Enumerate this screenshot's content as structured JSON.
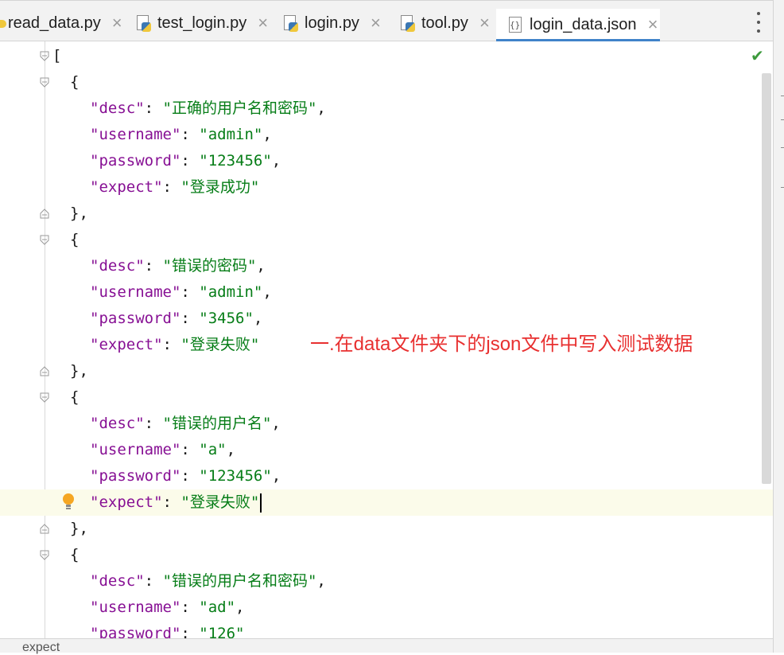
{
  "tabs": [
    {
      "label": "read_data.py",
      "close": "×",
      "icon": "python-file-icon"
    },
    {
      "label": "test_login.py",
      "close": "×",
      "icon": "python-file-icon"
    },
    {
      "label": "login.py",
      "close": "×",
      "icon": "python-file-icon"
    },
    {
      "label": "tool.py",
      "close": "×",
      "icon": "python-file-icon"
    },
    {
      "label": "login_data.json",
      "close": "×",
      "icon": "json-file-icon",
      "active": true
    }
  ],
  "colors": {
    "key": "#871094",
    "string": "#067d17",
    "annotation": "#e83030",
    "active_tab": "#4083c9"
  },
  "editor": {
    "lines": {
      "l0": "[",
      "l1": "{",
      "l2_key": "\"desc\"",
      "l2_val": "\"正确的用户名和密码\"",
      "l3_key": "\"username\"",
      "l3_val": "\"admin\"",
      "l4_key": "\"password\"",
      "l4_val": "\"123456\"",
      "l5_key": "\"expect\"",
      "l5_val": "\"登录成功\"",
      "l6": "},",
      "l7": "{",
      "l8_key": "\"desc\"",
      "l8_val": "\"错误的密码\"",
      "l9_key": "\"username\"",
      "l9_val": "\"admin\"",
      "l10_key": "\"password\"",
      "l10_val": "\"3456\"",
      "l11_key": "\"expect\"",
      "l11_val": "\"登录失败\"",
      "l12": "},",
      "l13": "{",
      "l14_key": "\"desc\"",
      "l14_val": "\"错误的用户名\"",
      "l15_key": "\"username\"",
      "l15_val": "\"a\"",
      "l16_key": "\"password\"",
      "l16_val": "\"123456\"",
      "l17_key": "\"expect\"",
      "l17_val": "\"登录失败\"",
      "l18": "},",
      "l19": "{",
      "l20_key": "\"desc\"",
      "l20_val": "\"错误的用户名和密码\"",
      "l21_key": "\"username\"",
      "l21_val": "\"ad\"",
      "l22_key": "\"password\"",
      "l22_val": "\"126\""
    },
    "colon": ": ",
    "comma": ","
  },
  "annotation": "一.在data文件夹下的json文件中写入测试数据",
  "breadcrumb": "expect"
}
